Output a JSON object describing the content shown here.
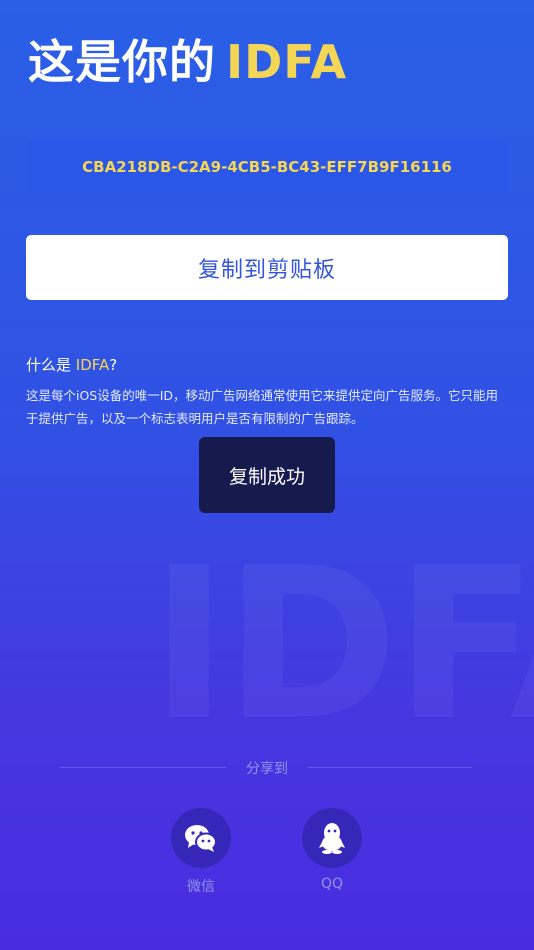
{
  "header": {
    "title_prefix": "这是你的",
    "title_accent": "IDFA"
  },
  "idfa": {
    "value": "CBA218DB-C2A9-4CB5-BC43-EFF7B9F16116"
  },
  "copy_button": {
    "label": "复制到剪贴板"
  },
  "info": {
    "title_prefix": "什么是 ",
    "title_highlight": "IDFA",
    "title_suffix": "?",
    "description": "这是每个iOS设备的唯一ID，移动广告网络通常使用它来提供定向广告服务。它只能用于提供广告，以及一个标志表明用户是否有限制的广告跟踪。"
  },
  "toast": {
    "message": "复制成功"
  },
  "watermark": {
    "text": "IDFA"
  },
  "share": {
    "label": "分享到",
    "items": [
      {
        "name": "微信",
        "icon": "wechat-icon"
      },
      {
        "name": "QQ",
        "icon": "qq-icon"
      }
    ]
  },
  "colors": {
    "accent_yellow": "#f4d657",
    "primary_blue": "#3454df",
    "toast_bg": "#161a4d",
    "share_circle": "#3528b8"
  }
}
